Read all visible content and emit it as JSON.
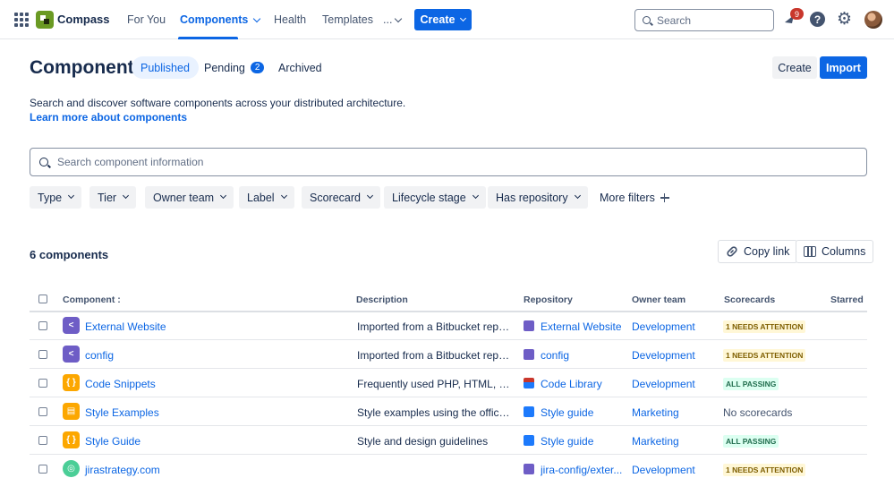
{
  "topnav": {
    "brand": "Compass",
    "items": [
      {
        "label": "For You"
      },
      {
        "label": "Components"
      },
      {
        "label": "Health"
      },
      {
        "label": "Templates"
      },
      {
        "label": "..."
      }
    ],
    "create_label": "Create",
    "search_placeholder": "Search",
    "notification_count": "9",
    "help_glyph": "?",
    "gear_glyph": "⚙"
  },
  "header": {
    "title": "Components",
    "tabs": [
      {
        "label": "Published",
        "active": true
      },
      {
        "label": "Pending",
        "count": "2"
      },
      {
        "label": "Archived"
      }
    ],
    "create_label": "Create",
    "import_label": "Import",
    "description": "Search and discover software components across your distributed architecture.",
    "learn_more": "Learn more about components"
  },
  "search": {
    "placeholder": "Search component information"
  },
  "filters": [
    "Type",
    "Tier",
    "Owner team",
    "Label",
    "Scorecard",
    "Lifecycle stage",
    "Has repository"
  ],
  "more_filters": "More filters",
  "list": {
    "count_label": "6 components",
    "copy_link": "Copy link",
    "columns": "Columns"
  },
  "table": {
    "headers": {
      "component": "Component :",
      "description": "Description",
      "repository": "Repository",
      "owner_team": "Owner team",
      "scorecards": "Scorecards",
      "starred": "Starred"
    },
    "rows": [
      {
        "name": "External Website",
        "icon": "share-icon",
        "icon_color": "#6e5dc6",
        "description": "Imported from a Bitbucket reposi...",
        "repo": "External Website",
        "repo_icon": "bitbucket-icon",
        "team": "Development",
        "score": "1 NEEDS ATTENTION",
        "score_type": "attn"
      },
      {
        "name": "config",
        "icon": "share-icon",
        "icon_color": "#6e5dc6",
        "description": "Imported from a Bitbucket reposi...",
        "repo": "config",
        "repo_icon": "bitbucket-icon",
        "team": "Development",
        "score": "1 NEEDS ATTENTION",
        "score_type": "attn"
      },
      {
        "name": "Code Snippets",
        "icon": "braces-icon",
        "icon_color": "#fca700",
        "description": "Frequently used PHP, HTML, JQL, ...",
        "repo": "Code Library",
        "repo_icon": "library-icon",
        "team": "Development",
        "score": "ALL PASSING",
        "score_type": "pass"
      },
      {
        "name": "Style Examples",
        "icon": "layout-icon",
        "icon_color": "#fca700",
        "description": "Style examples using the official s...",
        "repo": "Style guide",
        "repo_icon": "document-icon",
        "team": "Marketing",
        "score": "No scorecards",
        "score_type": "none"
      },
      {
        "name": "Style Guide",
        "icon": "braces-icon",
        "icon_color": "#fca700",
        "description": "Style and design guidelines",
        "repo": "Style guide",
        "repo_icon": "document-icon",
        "team": "Marketing",
        "score": "ALL PASSING",
        "score_type": "pass"
      },
      {
        "name": "jirastrategy.com",
        "icon": "globe-icon",
        "icon_color": "#4bce97",
        "description": "",
        "repo": "jira-config/exter...",
        "repo_icon": "bitbucket-icon",
        "team": "Development",
        "score": "1 NEEDS ATTENTION",
        "score_type": "attn"
      }
    ]
  }
}
